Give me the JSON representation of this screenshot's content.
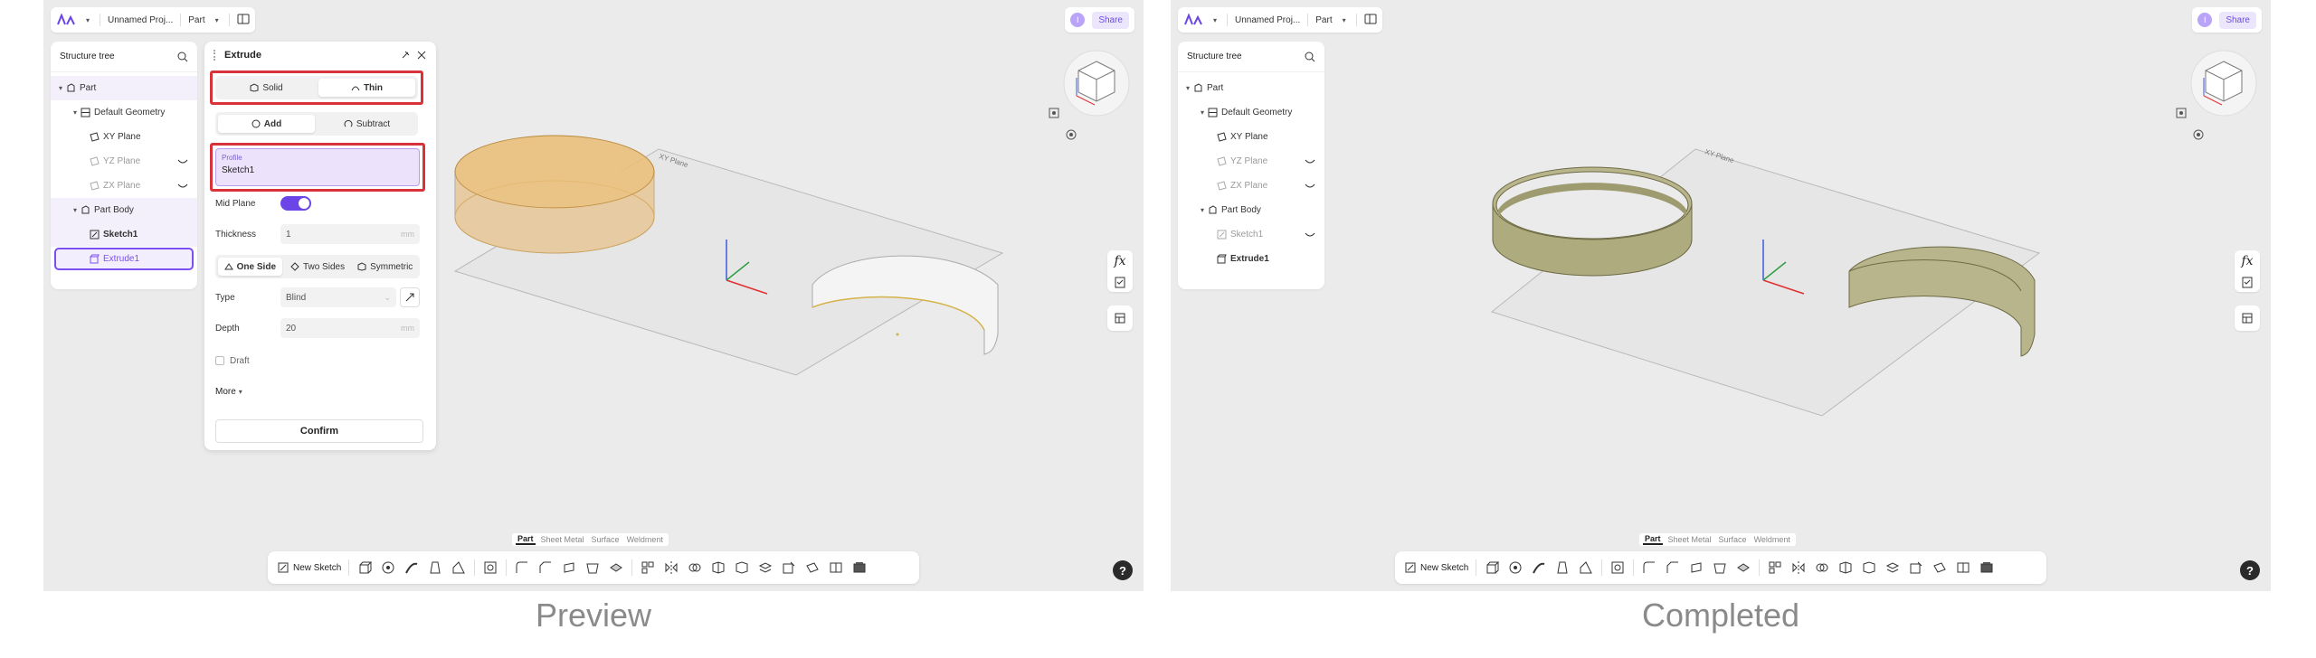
{
  "captions": {
    "left": "Preview",
    "right": "Completed"
  },
  "topbar": {
    "project": "Unnamed Proj...",
    "mode": "Part",
    "share": "Share",
    "avatar": "I"
  },
  "tree": {
    "title": "Structure tree",
    "items": [
      {
        "label": "Part"
      },
      {
        "label": "Default Geometry"
      },
      {
        "label": "XY Plane"
      },
      {
        "label": "YZ Plane"
      },
      {
        "label": "ZX Plane"
      },
      {
        "label": "Part Body"
      },
      {
        "label": "Sketch1"
      },
      {
        "label": "Extrude1"
      }
    ]
  },
  "panel": {
    "title": "Extrude",
    "solid": "Solid",
    "thin": "Thin",
    "add": "Add",
    "subtract": "Subtract",
    "profile_label": "Profile",
    "profile_value": "Sketch1",
    "mid_plane": "Mid Plane",
    "thickness_label": "Thickness",
    "thickness_value": "1",
    "unit": "mm",
    "one_side": "One Side",
    "two_sides": "Two Sides",
    "symmetric": "Symmetric",
    "type_label": "Type",
    "type_value": "Blind",
    "depth_label": "Depth",
    "depth_value": "20",
    "draft": "Draft",
    "more": "More",
    "confirm": "Confirm"
  },
  "viewport": {
    "plane_label": "XY Plane",
    "fx": "fx",
    "help": "?"
  },
  "toolbar": {
    "tabs": [
      "Part",
      "Sheet Metal",
      "Surface",
      "Weldment"
    ],
    "new_sketch": "New Sketch"
  },
  "colors": {
    "accent": "#7b4ff0",
    "highlight": "#d8323a",
    "preview_fill": "#e9bd74",
    "solid_fill": "#b8b58c"
  }
}
